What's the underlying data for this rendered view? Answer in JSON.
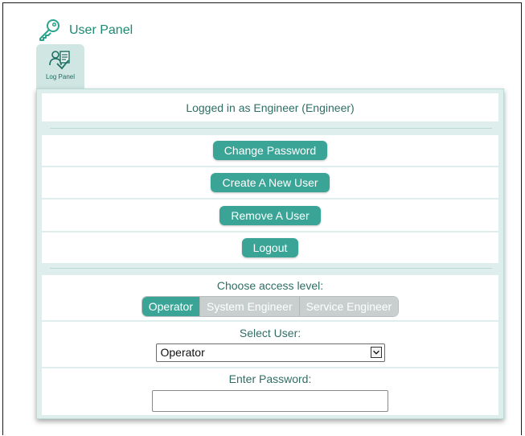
{
  "header": {
    "title": "User Panel",
    "icon": "key-icon"
  },
  "tab": {
    "label": "Log Panel",
    "icon": "users-log-icon"
  },
  "status": {
    "logged_in": "Logged in as Engineer (Engineer)"
  },
  "actions": {
    "change_password": "Change Password",
    "create_user": "Create A New User",
    "remove_user": "Remove A User",
    "logout": "Logout"
  },
  "access": {
    "label": "Choose access level:",
    "options": [
      "Operator",
      "System Engineer",
      "Service Engineer"
    ],
    "selected": "Operator"
  },
  "select_user": {
    "label": "Select User:",
    "value": "Operator"
  },
  "password": {
    "label": "Enter Password:",
    "value": ""
  },
  "colors": {
    "accent": "#3aa596",
    "panel_bg": "#ddeeec",
    "title": "#1a8a72",
    "disabled": "#c9cfcf"
  }
}
